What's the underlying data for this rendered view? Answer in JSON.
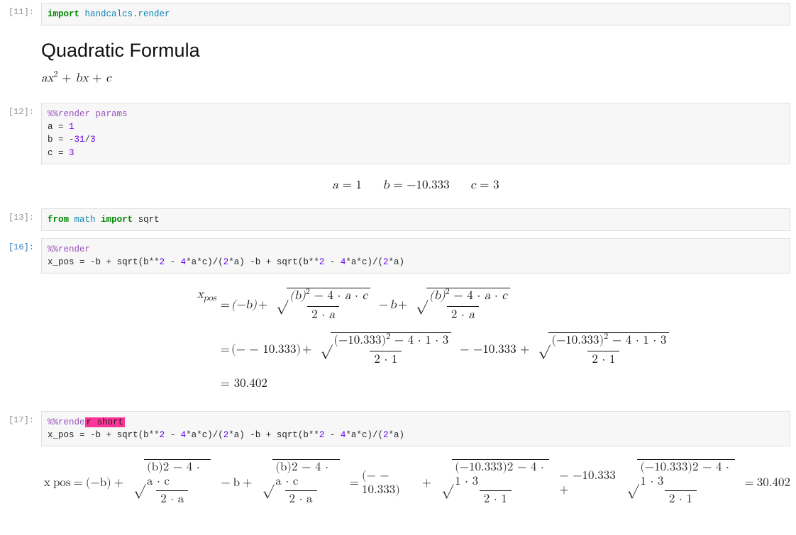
{
  "cells": {
    "c11": {
      "prompt": "[11]:",
      "code": {
        "import": "import",
        "pkg": "handcalcs.render"
      }
    },
    "markdown": {
      "title": "Quadratic Formula",
      "expr_a": "a",
      "expr_x": "x",
      "expr_sup": "2",
      "plus1": " + ",
      "expr_b": "b",
      "expr_x2": "x",
      "plus2": " + ",
      "expr_c": "c"
    },
    "c12": {
      "prompt": "[12]:",
      "magic": "%%render params",
      "lines": {
        "l1a": "a ",
        "l1eq": "= ",
        "l1v": "1",
        "l2a": "b ",
        "l2eq": "= ",
        "l2n": "-",
        "l2v1": "31",
        "l2s": "/",
        "l2v2": "3",
        "l3a": "c ",
        "l3eq": "= ",
        "l3v": "3"
      },
      "out": {
        "a_lbl": "a",
        "a_eq": " = ",
        "a_val": "1",
        "b_lbl": "b",
        "b_eq": " = ",
        "b_val": "−10.333",
        "c_lbl": "c",
        "c_eq": " = ",
        "c_val": "3"
      }
    },
    "c13": {
      "prompt": "[13]:",
      "from": "from",
      "mod": "math",
      "imp": "import",
      "name": "sqrt"
    },
    "c16": {
      "prompt": "[16]:",
      "magic": "%%render",
      "expr_pre": "x_pos ",
      "eq": "= ",
      "neg": "-",
      "rest1": "b ",
      "plus": "+ ",
      "sqrt": "sqrt(b",
      "pow": "**",
      "two": "2",
      "m4": " - ",
      "four": "4",
      "star": "*",
      "a": "a",
      "c": "c",
      "close_div": ")/(",
      "twoa": "2",
      "ap": ")",
      "mid": " -b + ",
      "out": {
        "lhs": "x",
        "lhs_sub": "pos",
        "eq": " = ",
        "neg_b": "(−b)",
        "plus": " + ",
        "sqrt_inner_sym": "(b)",
        "sq": "2",
        "minus": " − 4 · ",
        "a": "a",
        "dot": " · ",
        "cc": "c",
        "den": "2 · ",
        "den_a": "a",
        "mid_minus_b": " − ",
        "b_plain": "b",
        "line2_eq": "= ",
        "neg_neg": "(− − 10.333)",
        "plus2": " + ",
        "sqrt2_inner": "(−10.333)",
        "min4ac_num": " − 4 · 1 · 3",
        "den_num": "2 · 1",
        "mid_num": " − −10.333 + ",
        "line3_eq": "= ",
        "result": "30.402"
      }
    },
    "c17": {
      "prompt": "[17]:",
      "magic_pre": "%%rende",
      "magic_hl": "r short",
      "expr_pre": "x_pos ",
      "eq": "= ",
      "neg": "-",
      "rest1": "b ",
      "plus": "+ ",
      "out": {
        "eq1": " = ",
        "eq2": " = ",
        "eq3": " = ",
        "result": "30.402"
      }
    }
  }
}
